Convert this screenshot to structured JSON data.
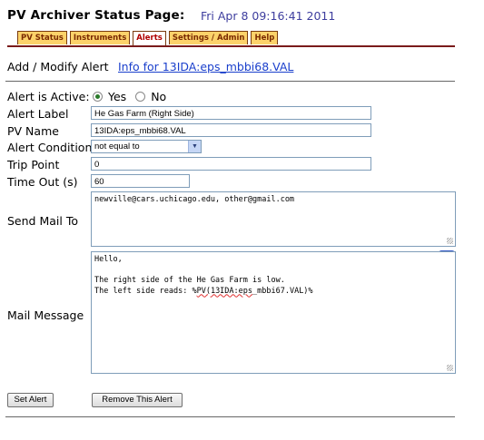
{
  "page": {
    "title": "PV Archiver Status Page:",
    "datetime": "Fri Apr 8 09:16:41 2011"
  },
  "tabs": [
    {
      "label": "PV Status",
      "active": false
    },
    {
      "label": "Instruments",
      "active": false
    },
    {
      "label": "Alerts",
      "active": true
    },
    {
      "label": "Settings / Admin",
      "active": false
    },
    {
      "label": "Help",
      "active": false
    }
  ],
  "section": {
    "heading": "Add / Modify Alert",
    "info_link": "Info for 13IDA:eps_mbbi68.VAL"
  },
  "form": {
    "active_label": "Alert is Active:",
    "active_yes": "Yes",
    "active_no": "No",
    "active_value": "Yes",
    "alert_label_label": "Alert Label",
    "alert_label_value": "He Gas Farm (Right Side)",
    "pv_name_label": "PV Name",
    "pv_name_value": "13IDA:eps_mbbi68.VAL",
    "condition_label": "Alert Condition",
    "condition_value": "not equal to",
    "trip_point_label": "Trip Point",
    "trip_point_value": "0",
    "timeout_label": "Time Out (s)",
    "timeout_value": "60",
    "send_mail_label": "Send Mail To",
    "send_mail_value": "newville@cars.uchicago.edu, other@gmail.com",
    "mail_message_label": "Mail Message",
    "mail_message_lines": {
      "l1": "Hello,",
      "l2": "",
      "l3": "The right side of the He Gas Farm is low.",
      "l4_prefix": "The left side reads: %",
      "l4_var": "PV(13IDA:eps",
      "l4_suffix": "_mbbi67.VAL)%"
    },
    "edit_badge": "edit"
  },
  "buttons": {
    "set_alert": "Set Alert",
    "remove_alert": "Remove This Alert"
  },
  "colors": {
    "tab_bg": "#fcd26a",
    "tab_active_text": "#b00000",
    "link": "#1a3fcc",
    "radio_selected": "#2a7a2a"
  }
}
